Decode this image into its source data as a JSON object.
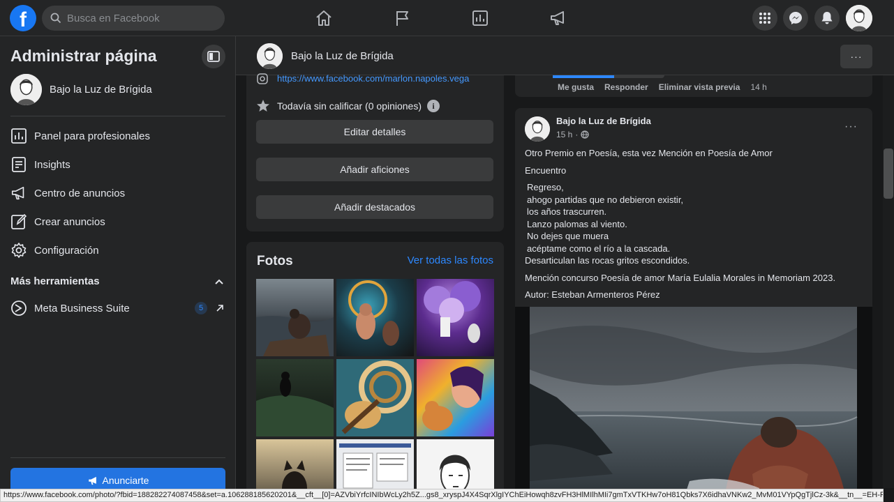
{
  "topbar": {
    "logo": "f",
    "search_placeholder": "Busca en Facebook",
    "nav_icons": [
      "home-icon",
      "flag-icon",
      "chart-icon",
      "megaphone-icon"
    ],
    "right_icons": [
      "grid-menu-icon",
      "messenger-icon",
      "bell-icon"
    ]
  },
  "sidebar": {
    "title": "Administrar página",
    "page_name": "Bajo la Luz de Brígida",
    "items": [
      {
        "label": "Panel para profesionales",
        "icon": "dashboard-icon"
      },
      {
        "label": "Insights",
        "icon": "insights-icon"
      },
      {
        "label": "Centro de anuncios",
        "icon": "megaphone-icon"
      },
      {
        "label": "Crear anuncios",
        "icon": "pencil-icon"
      },
      {
        "label": "Configuración",
        "icon": "gear-icon"
      }
    ],
    "more_tools": "Más herramientas",
    "meta_suite": "Meta Business Suite",
    "meta_badge": "5",
    "promote_button": "Anunciarte"
  },
  "page_header": {
    "name": "Bajo la Luz de Brígida",
    "more": "···"
  },
  "about": {
    "link": "https://www.facebook.com/marlon.napoles.vega",
    "rating": "Todavía sin calificar (0 opiniones)",
    "info": "i",
    "buttons": [
      "Editar detalles",
      "Añadir aficiones",
      "Añadir destacados"
    ]
  },
  "photos": {
    "title": "Fotos",
    "see_all": "Ver todas las fotos"
  },
  "prev_post": {
    "actions": [
      "Me gusta",
      "Responder",
      "Eliminar vista previa"
    ],
    "time": "14 h"
  },
  "post": {
    "author": "Bajo la Luz de Brígida",
    "time": "15 h",
    "more": "···",
    "line1": "Otro Premio en Poesía, esta vez Mención en  Poesía de Amor",
    "line2": "Encuentro",
    "poem": [
      " Regreso,",
      " ahogo partidas que no debieron existir,",
      " los años trascurren.",
      " Lanzo palomas al viento.",
      " No dejes que muera",
      " acéptame como el río a la cascada.",
      "Desarticulan las rocas gritos escondidos."
    ],
    "line3": "Mención concurso Poesía de amor María Eulalia Morales in Memoriam 2023.",
    "line4": "Autor: Esteban Armenteros Pérez"
  },
  "statusbar": "https://www.facebook.com/photo/?fbid=188282274087458&set=a.106288185620201&__cft__[0]=AZVbiYrfcINIbWcLy2h5Z...gs8_xryspJ4X4SqrXlgIYChEiHowqh8zvFH3HlMIlhMIi7gmTxVTKHw7oH81Qbks7X6idhaVNKw2_MvM01VYpQgTjlCz-3k&__tn__=EH-R"
}
